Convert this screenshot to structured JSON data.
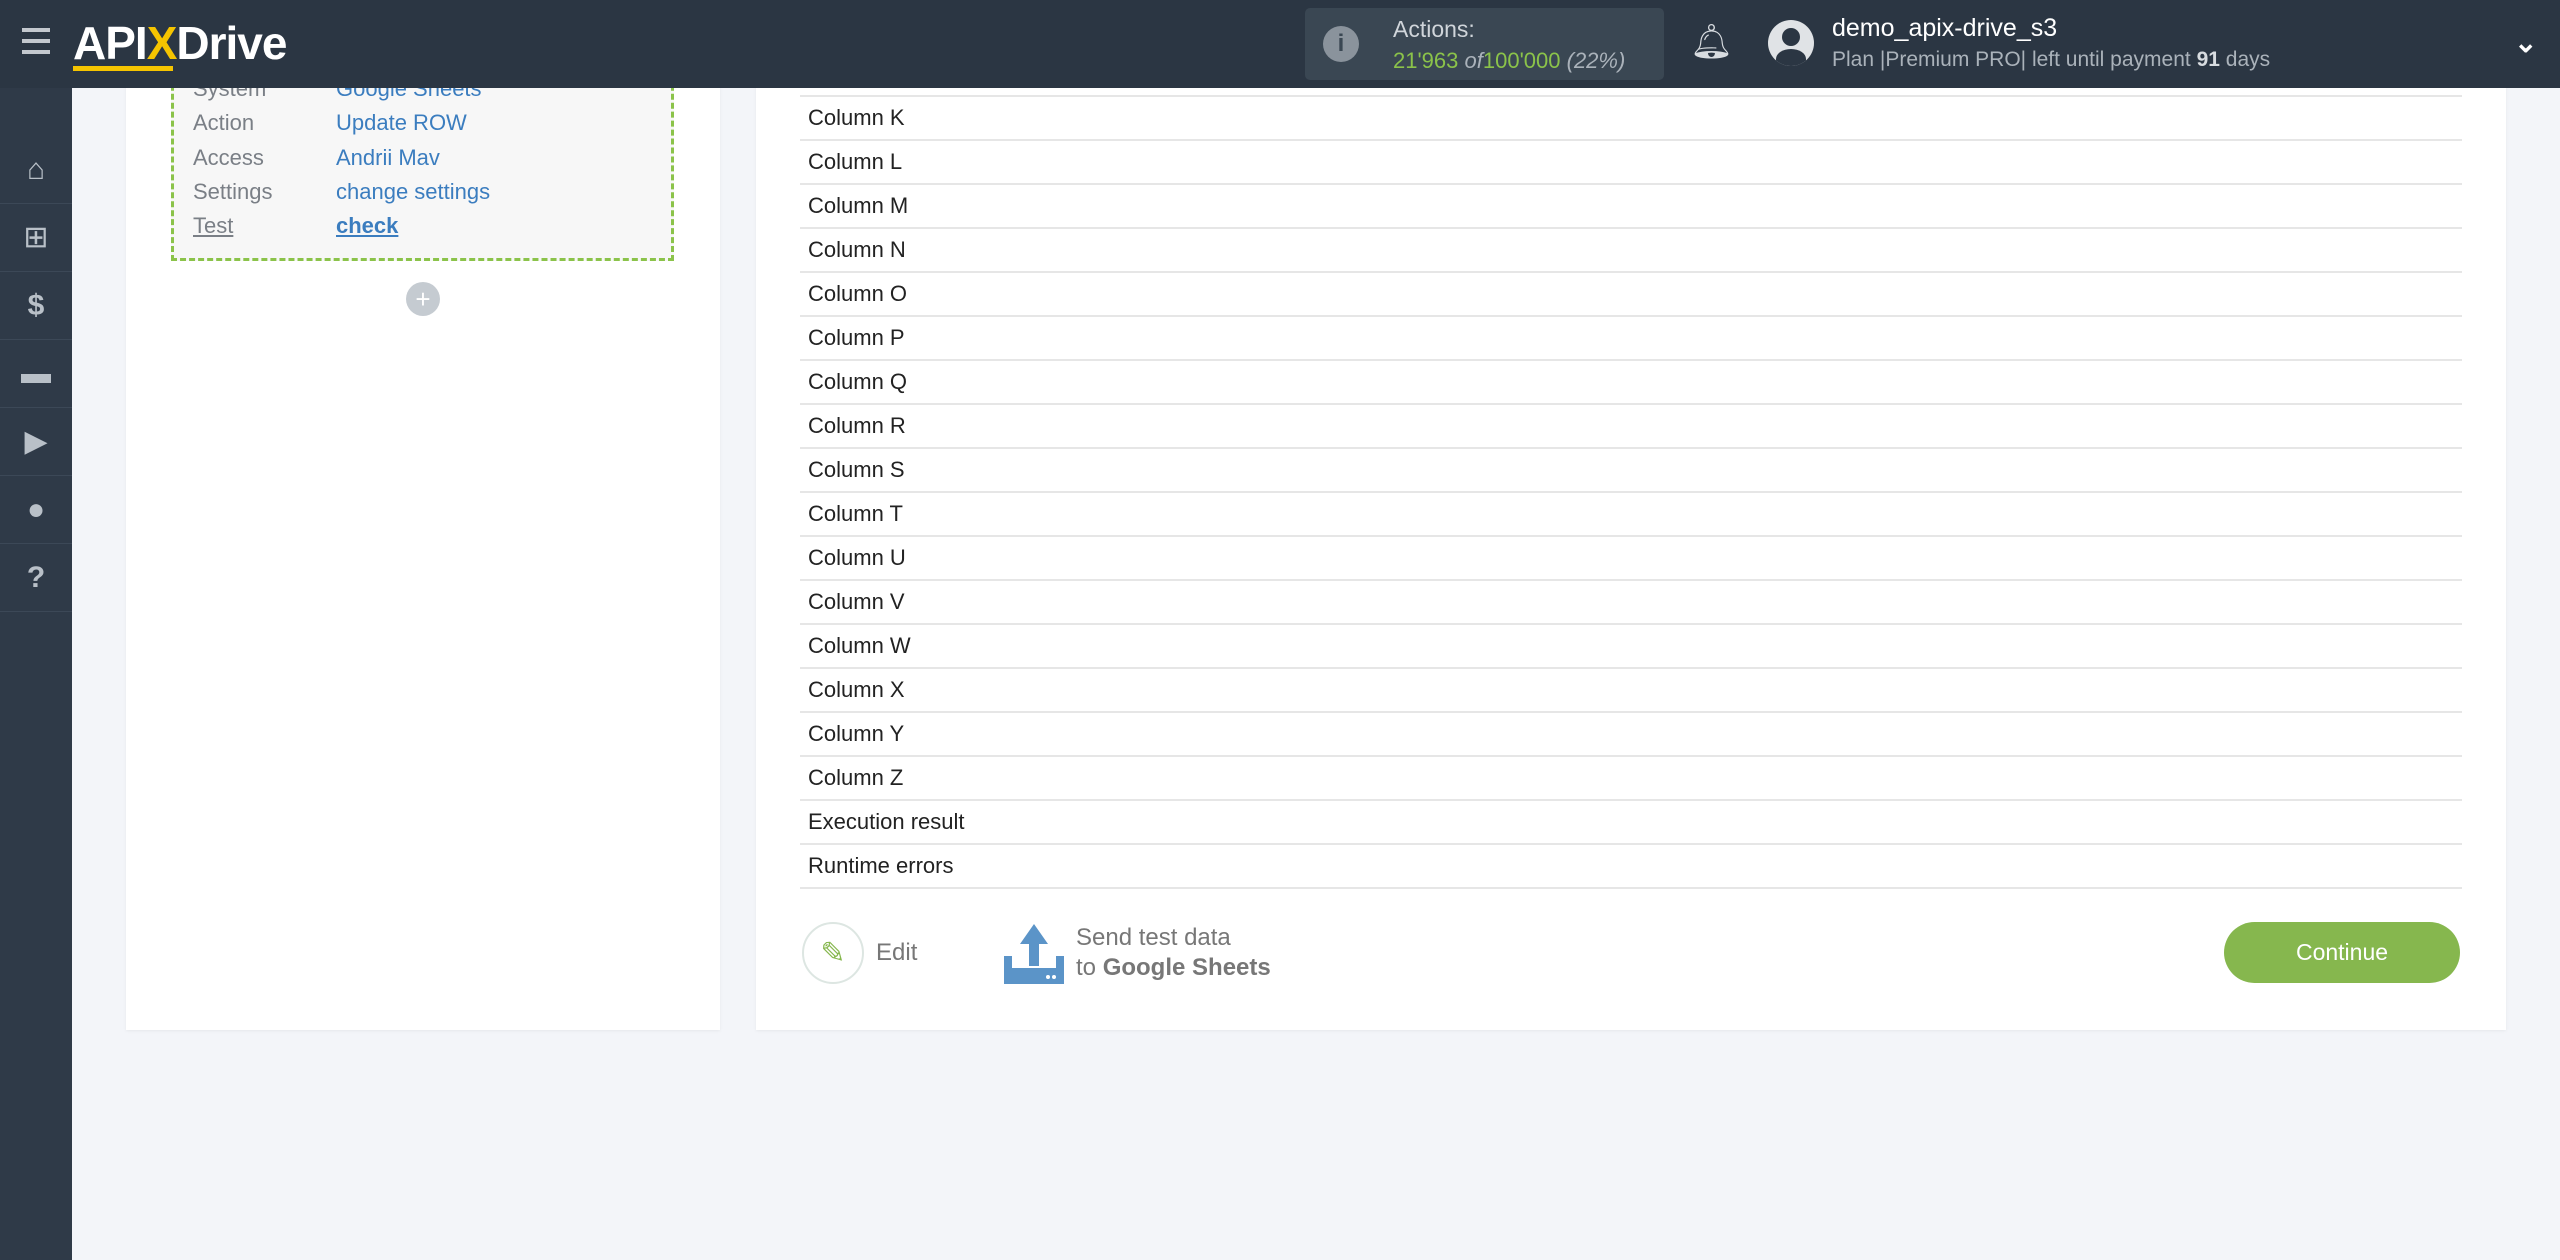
{
  "header": {
    "logo": "APIXDrive",
    "actions_label": "Actions:",
    "actions_used": "21'963",
    "actions_of": "of",
    "actions_total": "100'000",
    "actions_pct": "(22%)",
    "username": "demo_apix-drive_s3",
    "plan_prefix": "Plan |Premium PRO| left until payment",
    "days": "91",
    "days_suffix": "days"
  },
  "sidebar": [
    "home",
    "sitemap",
    "dollar",
    "briefcase",
    "youtube",
    "user",
    "help"
  ],
  "connection": {
    "rows": [
      {
        "label": "System",
        "value": "Google Sheets"
      },
      {
        "label": "Action",
        "value": "Update ROW"
      },
      {
        "label": "Access",
        "value": "Andrii Mav"
      },
      {
        "label": "Settings",
        "value": "change settings"
      },
      {
        "label": "Test",
        "value": "check"
      }
    ],
    "add": "+"
  },
  "fields": [
    "Column K",
    "Column L",
    "Column M",
    "Column N",
    "Column O",
    "Column P",
    "Column Q",
    "Column R",
    "Column S",
    "Column T",
    "Column U",
    "Column V",
    "Column W",
    "Column X",
    "Column Y",
    "Column Z",
    "Execution result",
    "Runtime errors"
  ],
  "actions": {
    "edit": "Edit",
    "send_line1": "Send test data",
    "send_to": "to",
    "send_target": "Google Sheets",
    "continue": "Continue"
  },
  "colors": {
    "accent": "#86b74e",
    "link": "#3b7dbf",
    "header": "#2b3643"
  }
}
